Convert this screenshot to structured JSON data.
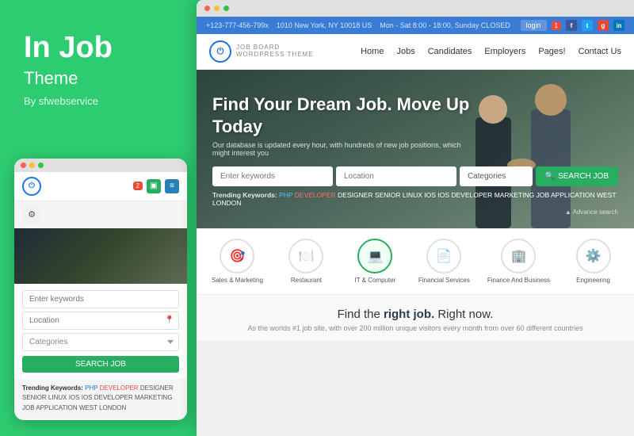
{
  "left": {
    "brand_title": "In Job",
    "brand_subtitle": "Theme",
    "brand_author": "By sfwebservice"
  },
  "phone": {
    "dots": [
      "red",
      "yellow",
      "green"
    ],
    "nav": {
      "notifications": "2",
      "icons": [
        "green",
        "blue"
      ]
    },
    "search": {
      "keywords_placeholder": "Enter keywords",
      "location_placeholder": "Location",
      "categories_placeholder": "Categories",
      "search_btn": "SEARCH JOB"
    },
    "trending": {
      "label": "Trending Keywords:",
      "keywords": [
        "PHP",
        "DEVELOPER",
        "DESIGNER",
        "SENIOR",
        "LINUX",
        "IOS",
        "IOS DEVELOPER",
        "MARKETING",
        "JOB APPLICATION",
        "WEST LONDON"
      ]
    }
  },
  "browser": {
    "topbar": {
      "phone": "+123-777-456-799x",
      "address": "1010 New York, NY 10018 US",
      "hours": "Mon - Sat 8:00 - 18:00, Sunday CLOSED",
      "login_label": "login",
      "social": [
        "f",
        "t",
        "g+",
        "in"
      ]
    },
    "navbar": {
      "logo_text": "JOB BOARD",
      "logo_sub": "WORDPRESS THEME",
      "menu": [
        "Home",
        "Jobs",
        "Candidates",
        "Employers",
        "Pages!",
        "Contact Us"
      ]
    },
    "hero": {
      "title": "Find Your Dream Job. Move Up Today",
      "subtitle": "Our database is updated every hour, with hundreds of new job positions, which might interest you",
      "search_keywords_placeholder": "Enter keywords",
      "search_location_placeholder": "Location",
      "search_categories_placeholder": "Categories",
      "search_btn": "SEARCH JOB",
      "trending_label": "Trending Keywords:",
      "trending_keywords": [
        "PHP",
        "DEVELOPER",
        "DESIGNER",
        "SENIOR",
        "LINUX",
        "IOS",
        "IOS DEVELOPER",
        "MARKETING",
        "JOB APPLICATION",
        "WEST LONDON"
      ],
      "advance_search": "▲ Advance search"
    },
    "categories": [
      {
        "icon": "🎯",
        "label": "Sales & Marketing"
      },
      {
        "icon": "🍽️",
        "label": "Restaurant"
      },
      {
        "icon": "💻",
        "label": "IT & Computer",
        "active": true
      },
      {
        "icon": "📄",
        "label": "Financial Services"
      },
      {
        "icon": "🏢",
        "label": "Finance And Business"
      },
      {
        "icon": "⚙️",
        "label": "Engineering"
      }
    ],
    "bottom": {
      "title_prefix": "Find the ",
      "title_emphasis": "right job.",
      "title_suffix": " Right now.",
      "description": "As the worlds #1 job site, with over 200 million unique visitors every month from over 60 different countries"
    }
  }
}
